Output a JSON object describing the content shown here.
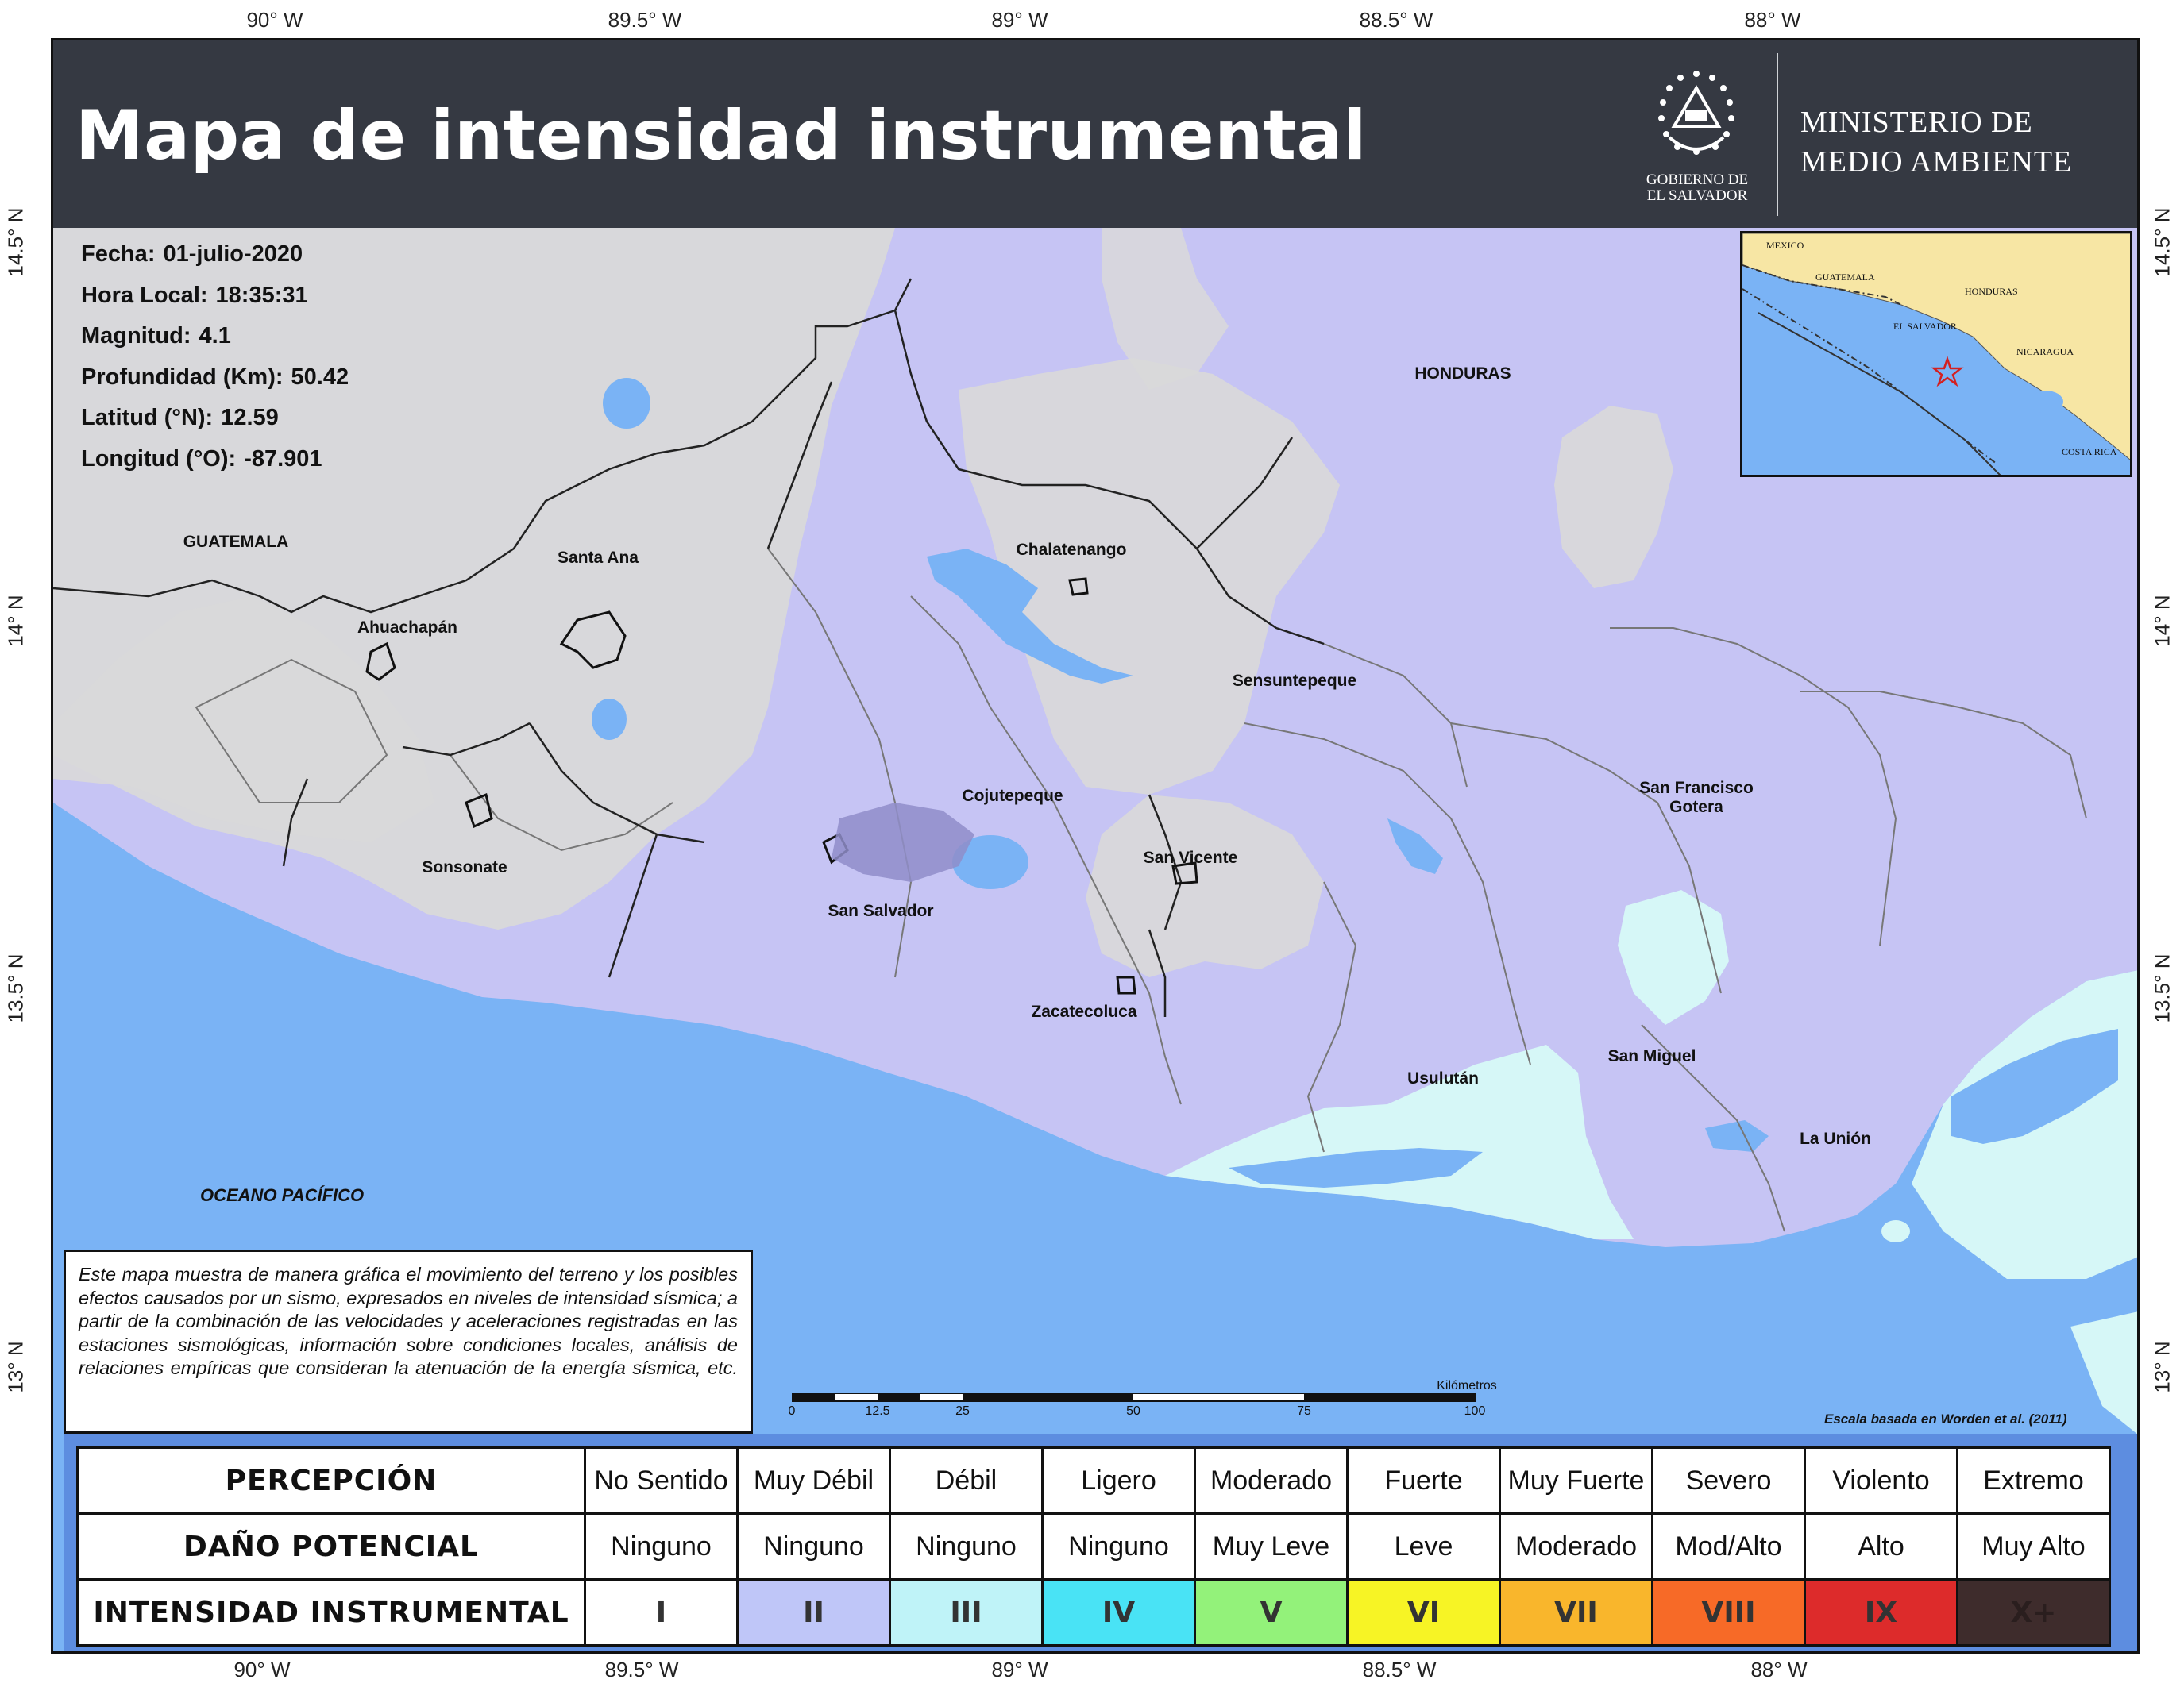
{
  "coords": {
    "top": [
      "90° W",
      "89.5° W",
      "89° W",
      "88.5° W",
      "88° W"
    ],
    "bottom": [
      "90° W",
      "89.5° W",
      "89° W",
      "88.5° W",
      "88° W"
    ],
    "left": [
      "14.5° N",
      "14° N",
      "13.5° N",
      "13° N"
    ],
    "right": [
      "14.5° N",
      "14° N",
      "13.5° N",
      "13° N"
    ]
  },
  "header": {
    "title": "Mapa de intensidad instrumental",
    "gov_line1": "GOBIERNO DE",
    "gov_line2": "EL SALVADOR",
    "ministry_line1": "MINISTERIO DE",
    "ministry_line2": "MEDIO AMBIENTE"
  },
  "event": {
    "fecha_label": "Fecha:",
    "fecha": "01-julio-2020",
    "hora_label": "Hora Local:",
    "hora": "18:35:31",
    "magnitud_label": "Magnitud:",
    "magnitud": "4.1",
    "profundidad_label": "Profundidad (Km):",
    "profundidad": "50.42",
    "latitud_label": "Latitud (°N):",
    "latitud": "12.59",
    "longitud_label": "Longitud (°O):",
    "longitud": "-87.901"
  },
  "places": {
    "guatemala": "GUATEMALA",
    "honduras": "HONDURAS",
    "santa_ana": "Santa Ana",
    "ahuachapan": "Ahuachapán",
    "chalatenango": "Chalatenango",
    "sensuntepeque": "Sensuntepeque",
    "sonsonate": "Sonsonate",
    "cojutepeque": "Cojutepeque",
    "san_vicente": "San Vicente",
    "san_salvador": "San Salvador",
    "zacatecoluca": "Zacatecoluca",
    "san_francisco_gotera_1": "San Francisco",
    "san_francisco_gotera_2": "Gotera",
    "usulutan": "Usulután",
    "san_miguel": "San Miguel",
    "la_union": "La Unión",
    "ocean": "OCEANO PACÍFICO"
  },
  "inset": {
    "mexico": "MEXICO",
    "guatemala": "GUATEMALA",
    "honduras": "HONDURAS",
    "el_salvador": "EL SALVADOR",
    "nicaragua": "NICARAGUA",
    "costa_rica": "COSTA RICA"
  },
  "note": "Este mapa muestra de manera gráfica el movimiento del terreno y los posibles efectos causados por un sismo, expresados en niveles de intensidad sísmica; a partir de la combinación de las velocidades y aceleraciones registradas en las estaciones sismológicas, información sobre condiciones locales, análisis de relaciones empíricas que consideran la atenuación de la energía sísmica, etc.",
  "scale": {
    "unit": "Kilómetros",
    "ticks": [
      "0",
      "12.5",
      "25",
      "50",
      "75",
      "100"
    ],
    "reference": "Escala basada en Worden et al. (2011)"
  },
  "legend": {
    "row_perception": "PERCEPCIÓN",
    "row_damage": "DAÑO POTENCIAL",
    "row_intensity": "INTENSIDAD INSTRUMENTAL",
    "perception": [
      "No Sentido",
      "Muy Débil",
      "Débil",
      "Ligero",
      "Moderado",
      "Fuerte",
      "Muy Fuerte",
      "Severo",
      "Violento",
      "Extremo"
    ],
    "damage": [
      "Ninguno",
      "Ninguno",
      "Ninguno",
      "Ninguno",
      "Muy Leve",
      "Leve",
      "Moderado",
      "Mod/Alto",
      "Alto",
      "Muy Alto"
    ],
    "intensity": [
      "I",
      "II",
      "III",
      "IV",
      "V",
      "VI",
      "VII",
      "VIII",
      "IX",
      "X+"
    ],
    "colors": [
      "#ffffff",
      "#bfc6f8",
      "#bff3f8",
      "#49e3f5",
      "#93f27a",
      "#f7f425",
      "#f9b62c",
      "#f76a27",
      "#dd2b2b",
      "#3e2c2c"
    ]
  },
  "map_colors": {
    "ocean": "#7ab3f5",
    "intensity_ii": "#c6c4f4",
    "intensity_iii": "#d6f7f7",
    "terrain": "#dcdcdc",
    "water": "#7ab3f5",
    "land_inset": "#f7e6a4"
  }
}
